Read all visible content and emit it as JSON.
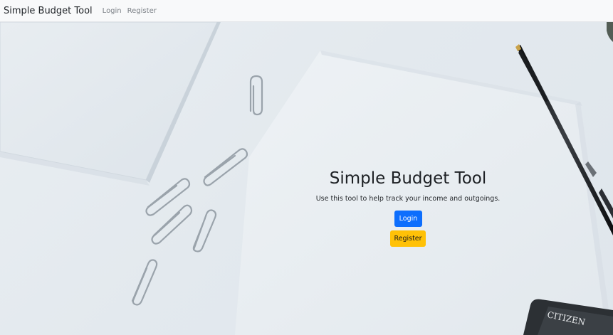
{
  "navbar": {
    "brand": "Simple Budget Tool",
    "links": [
      "Login",
      "Register"
    ]
  },
  "hero": {
    "title": "Simple Budget Tool",
    "subtitle": "Use this tool to help track your income and outgoings.",
    "login_button": "Login",
    "register_button": "Register",
    "calculator_brand": "CITIZEN"
  },
  "colors": {
    "primary": "#0d6efd",
    "warning": "#ffc107",
    "navbar_bg": "#f8f9fa"
  }
}
